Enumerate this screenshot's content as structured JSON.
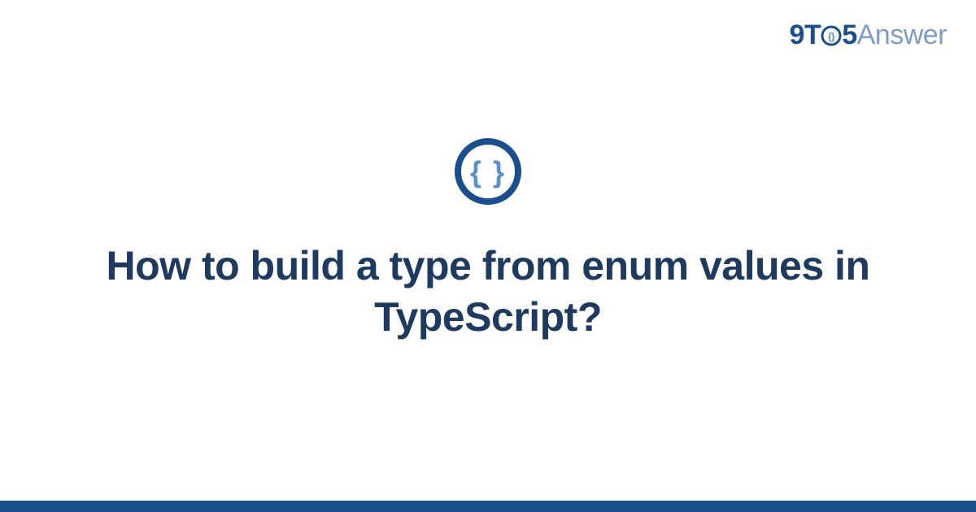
{
  "logo": {
    "part1": "9T",
    "part2": "5",
    "part3": "Answer"
  },
  "icon": {
    "name": "code-braces-icon",
    "glyph": "{ }"
  },
  "title": "How to build a type from enum values in TypeScript?",
  "colors": {
    "primary": "#1a4e8c",
    "secondary": "#5b8fc7",
    "title_color": "#1e3a5f",
    "logo_light": "#7a9cc6"
  }
}
